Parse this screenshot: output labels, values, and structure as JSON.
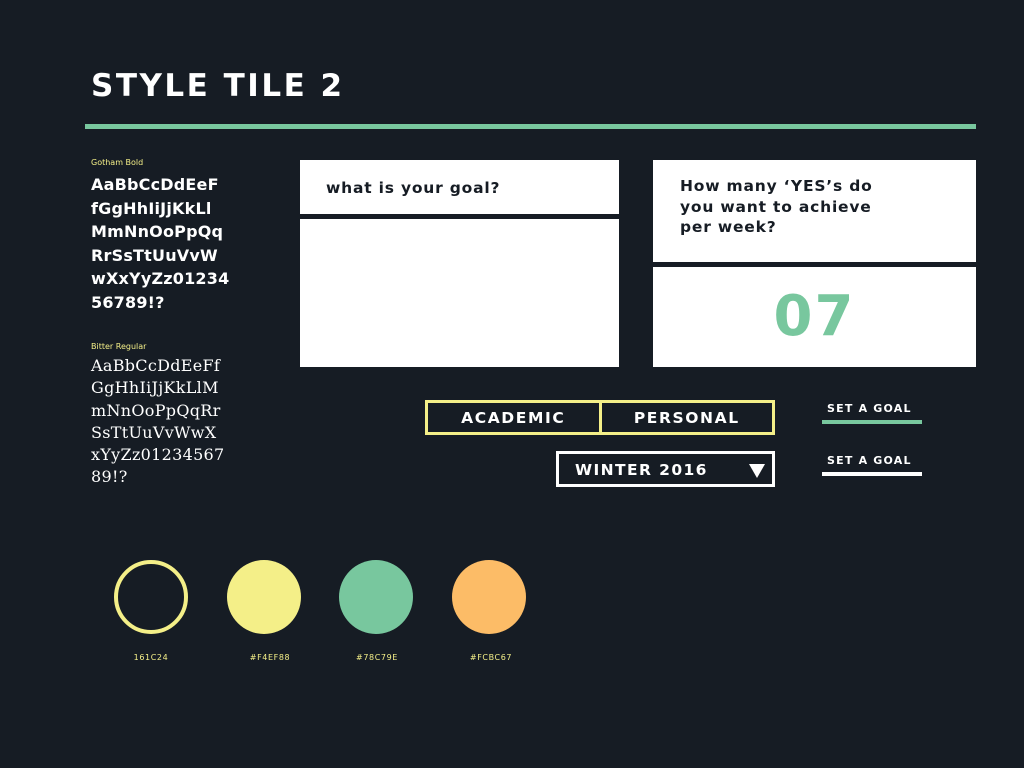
{
  "title": "STYLE TILE 2",
  "colors": {
    "background": "#161c24",
    "accent_green": "#78c79e",
    "accent_yellow": "#f4ef88",
    "accent_orange": "#fcbc67",
    "card": "#ffffff"
  },
  "typography": [
    {
      "name": "Gotham Bold",
      "lines": [
        "AaBbCcDdEeF",
        "fGgHhIiJjKkLl",
        "MmNnOoPpQq",
        "RrSsTtUuVvW",
        "wXxYyZz01234",
        "56789!?"
      ]
    },
    {
      "name": "Bitter Regular",
      "lines": [
        "AaBbCcDdEeFf",
        "GgHhIiJjKkLlM",
        "mNnOoPpQqRr",
        "SsTtUuVvWwX",
        "xYyZz01234567",
        "89!?"
      ]
    }
  ],
  "cards": {
    "goal_question": "what is your goal?",
    "goal_answer": "",
    "yes_question_lines": [
      "How many ‘YES’s do",
      "you want to achieve",
      "per week?"
    ],
    "yes_answer": "07"
  },
  "toggle": {
    "options": [
      "ACADEMIC",
      "PERSONAL"
    ]
  },
  "dropdown": {
    "selected": "WINTER 2016",
    "icon": "triangle-down-icon"
  },
  "buttons": [
    {
      "label": "SET A GOAL",
      "underline_color": "#78c79e"
    },
    {
      "label": "SET A GOAL",
      "underline_color": "#ffffff"
    }
  ],
  "swatches": [
    {
      "label": "161C24",
      "fill": "#161c24",
      "ring": "#f4ef88"
    },
    {
      "label": "#F4EF88",
      "fill": "#f4ef88",
      "ring": ""
    },
    {
      "label": "#78C79E",
      "fill": "#78c79e",
      "ring": ""
    },
    {
      "label": "#FCBC67",
      "fill": "#fcbc67",
      "ring": ""
    }
  ]
}
